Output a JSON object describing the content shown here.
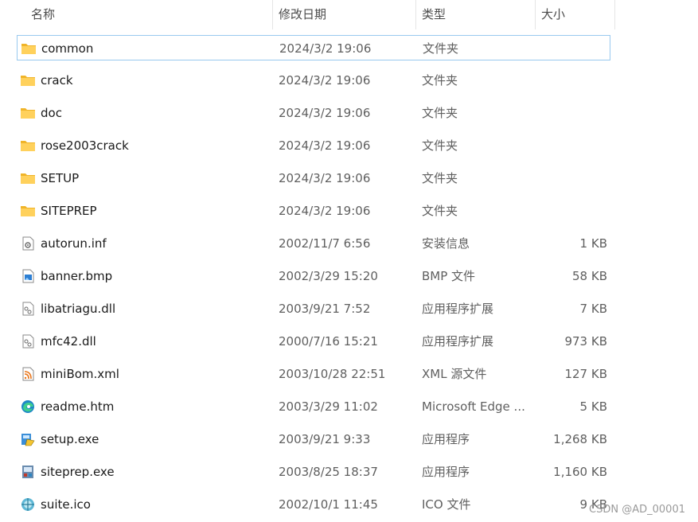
{
  "columns": {
    "name": "名称",
    "date": "修改日期",
    "type": "类型",
    "size": "大小"
  },
  "sort": {
    "column": "name",
    "icon": "sort-up-arrow-icon"
  },
  "files": [
    {
      "name": "common",
      "date": "2024/3/2 19:06",
      "type": "文件夹",
      "size": "",
      "icon": "folder-icon",
      "selected": true
    },
    {
      "name": "crack",
      "date": "2024/3/2 19:06",
      "type": "文件夹",
      "size": "",
      "icon": "folder-icon"
    },
    {
      "name": "doc",
      "date": "2024/3/2 19:06",
      "type": "文件夹",
      "size": "",
      "icon": "folder-icon"
    },
    {
      "name": "rose2003crack",
      "date": "2024/3/2 19:06",
      "type": "文件夹",
      "size": "",
      "icon": "folder-icon"
    },
    {
      "name": "SETUP",
      "date": "2024/3/2 19:06",
      "type": "文件夹",
      "size": "",
      "icon": "folder-icon"
    },
    {
      "name": "SITEPREP",
      "date": "2024/3/2 19:06",
      "type": "文件夹",
      "size": "",
      "icon": "folder-icon"
    },
    {
      "name": "autorun.inf",
      "date": "2002/11/7 6:56",
      "type": "安装信息",
      "size": "1 KB",
      "icon": "settings-file-icon"
    },
    {
      "name": "banner.bmp",
      "date": "2002/3/29 15:20",
      "type": "BMP 文件",
      "size": "58 KB",
      "icon": "image-file-icon"
    },
    {
      "name": "libatriagu.dll",
      "date": "2003/9/21 7:52",
      "type": "应用程序扩展",
      "size": "7 KB",
      "icon": "dll-file-icon"
    },
    {
      "name": "mfc42.dll",
      "date": "2000/7/16 15:21",
      "type": "应用程序扩展",
      "size": "973 KB",
      "icon": "dll-file-icon"
    },
    {
      "name": "miniBom.xml",
      "date": "2003/10/28 22:51",
      "type": "XML 源文件",
      "size": "127 KB",
      "icon": "xml-file-icon"
    },
    {
      "name": "readme.htm",
      "date": "2003/3/29 11:02",
      "type": "Microsoft Edge ...",
      "size": "5 KB",
      "icon": "edge-icon"
    },
    {
      "name": "setup.exe",
      "date": "2003/9/21 9:33",
      "type": "应用程序",
      "size": "1,268 KB",
      "icon": "setup-exe-icon"
    },
    {
      "name": "siteprep.exe",
      "date": "2003/8/25 18:37",
      "type": "应用程序",
      "size": "1,160 KB",
      "icon": "exe-icon"
    },
    {
      "name": "suite.ico",
      "date": "2002/10/1 11:45",
      "type": "ICO 文件",
      "size": "9 KB",
      "icon": "ico-file-icon"
    }
  ],
  "watermark": "CSDN @AD_00001"
}
